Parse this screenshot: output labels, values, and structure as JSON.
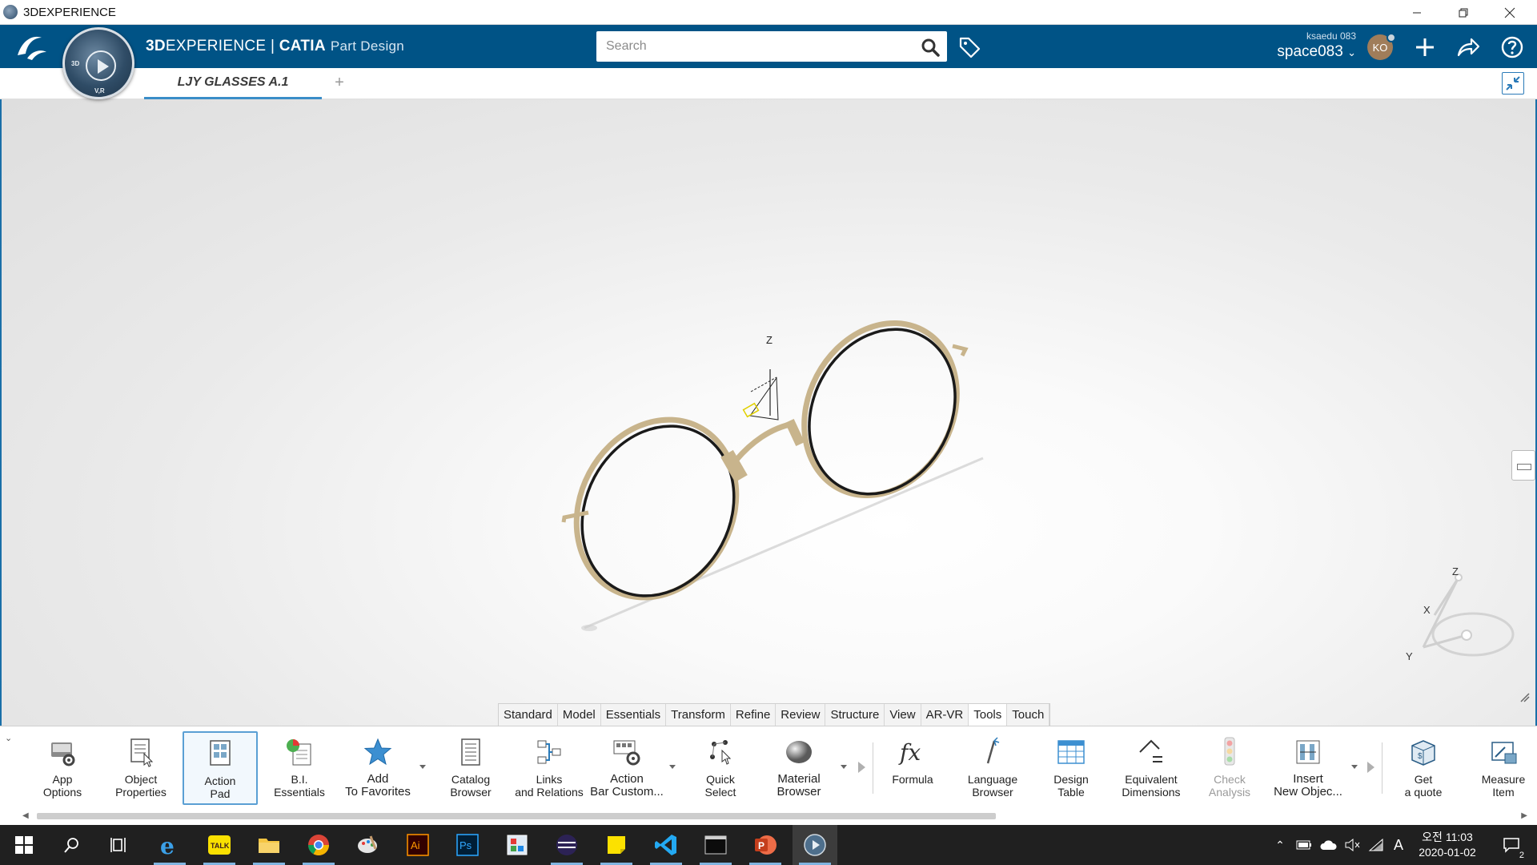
{
  "window": {
    "title": "3DEXPERIENCE"
  },
  "header": {
    "brand_bold": "3D",
    "brand_rest": "EXPERIENCE | ",
    "brand_catia": "CATIA",
    "app_name": "Part Design",
    "search_placeholder": "Search",
    "user_name": "ksaedu 083",
    "space_name": "space083",
    "avatar_initials": "KO",
    "accent_color": "#005386"
  },
  "compass": {
    "top_label": "3D",
    "bottom_label": "V,R"
  },
  "tabs": {
    "active_tab": "LJY GLASSES A.1",
    "add_label": "+"
  },
  "viewport": {
    "robot_axes": [
      "Z",
      "X",
      "Y"
    ],
    "compass_axes": [
      "Z",
      "X",
      "Y"
    ],
    "model_color": "#c8b48c"
  },
  "section_tabs": [
    "Standard",
    "Model",
    "Essentials",
    "Transform",
    "Refine",
    "Review",
    "Structure",
    "View",
    "AR-VR",
    "Tools",
    "Touch"
  ],
  "section_active": "Tools",
  "tools": [
    {
      "label1": "App",
      "label2": "Options",
      "icon": "app-options-icon"
    },
    {
      "label1": "Object",
      "label2": "Properties",
      "icon": "object-properties-icon"
    },
    {
      "label1": "Action",
      "label2": "Pad",
      "icon": "action-pad-icon",
      "selected": true
    },
    {
      "label1": "B.I.",
      "label2": "Essentials",
      "icon": "bi-essentials-icon"
    },
    {
      "label1": "Add",
      "label2": "To Favorites",
      "icon": "star-icon"
    },
    {
      "label1": "Catalog",
      "label2": "Browser",
      "icon": "catalog-icon"
    },
    {
      "label1": "Links",
      "label2": "and Relations",
      "icon": "links-icon"
    },
    {
      "label1": "Action",
      "label2": "Bar Custom...",
      "icon": "customize-icon"
    },
    {
      "label1": "Quick",
      "label2": "Select",
      "icon": "quick-select-icon"
    },
    {
      "label1": "Material",
      "label2": "Browser",
      "icon": "material-sphere-icon"
    },
    {
      "label1": "Formula",
      "label2": "",
      "icon": "formula-icon"
    },
    {
      "label1": "Language",
      "label2": "Browser",
      "icon": "language-icon"
    },
    {
      "label1": "Design",
      "label2": "Table",
      "icon": "table-icon"
    },
    {
      "label1": "Equivalent",
      "label2": "Dimensions",
      "icon": "dimensions-icon"
    },
    {
      "label1": "Check",
      "label2": "Analysis",
      "icon": "traffic-light-icon",
      "disabled": true
    },
    {
      "label1": "Insert",
      "label2": "New Objec...",
      "icon": "insert-icon"
    },
    {
      "label1": "Get",
      "label2": "a quote",
      "icon": "quote-box-icon"
    },
    {
      "label1": "Measure",
      "label2": "Item",
      "icon": "measure-icon"
    }
  ],
  "taskbar": {
    "clock_period": "오전 11:03",
    "clock_date": "2020-01-02",
    "ime": "A",
    "notifications": "2"
  }
}
